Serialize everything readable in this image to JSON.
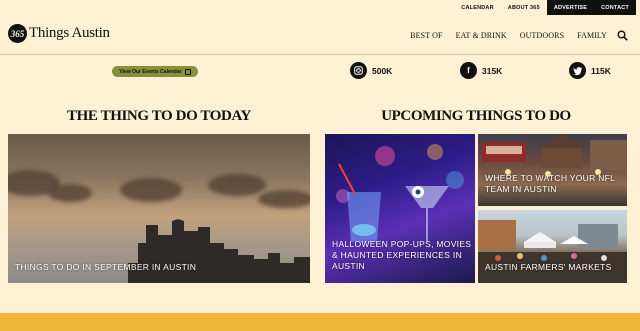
{
  "topbar": {
    "calendar": "CALENDAR",
    "about": "ABOUT 365",
    "advertise": "ADVERTISE",
    "contact": "CONTACT"
  },
  "logo": {
    "badge": "365",
    "text": "Things Austin"
  },
  "nav": {
    "best_of": "BEST OF",
    "eat_drink": "EAT & DRINK",
    "outdoors": "OUTDOORS",
    "family": "FAMILY"
  },
  "events_button": "View Our Events Calendar",
  "social": {
    "instagram": "500K",
    "facebook": "315K",
    "twitter": "115K"
  },
  "sections": {
    "today": "THE THING TO DO TODAY",
    "upcoming": "UPCOMING THINGS TO DO"
  },
  "cards": {
    "september": "THINGS TO DO IN SEPTEMBER IN AUSTIN",
    "halloween": "HALLOWEEN POP-UPS, MOVIES & HAUNTED EXPERIENCES IN AUSTIN",
    "nfl": "WHERE TO WATCH YOUR NFL TEAM IN AUSTIN",
    "farmers": "AUSTIN FARMERS' MARKETS"
  },
  "colors": {
    "background": "#fdf0d5",
    "events_button": "#8a8f3a",
    "bottom_strip": "#f2b73a"
  }
}
